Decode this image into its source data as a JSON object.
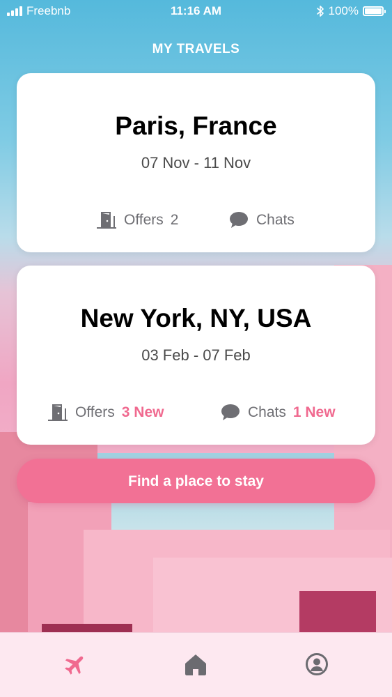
{
  "status_bar": {
    "carrier": "Freebnb",
    "time": "11:16 AM",
    "battery": "100%"
  },
  "page": {
    "title": "MY TRAVELS"
  },
  "trips": [
    {
      "city": "Paris, France",
      "dates": "07 Nov - 11 Nov",
      "offers_label": "Offers",
      "offers_count": "2",
      "chats_label": "Chats"
    },
    {
      "city": "New York, NY, USA",
      "dates": "03 Feb - 07 Feb",
      "offers_label": "Offers",
      "offers_new": "3 New",
      "chats_label": "Chats",
      "chats_new": "1 New"
    }
  ],
  "cta": {
    "label": "Find a place to stay"
  },
  "tab_bar": {
    "items": [
      {
        "icon": "airplane-icon",
        "active": true
      },
      {
        "icon": "home-icon",
        "active": false
      },
      {
        "icon": "user-circle-icon",
        "active": false
      }
    ]
  },
  "colors": {
    "accent": "#f27195",
    "new_badge": "#f0698f",
    "icon_gray": "#6e6e73",
    "tab_inactive": "#6b6b70"
  }
}
